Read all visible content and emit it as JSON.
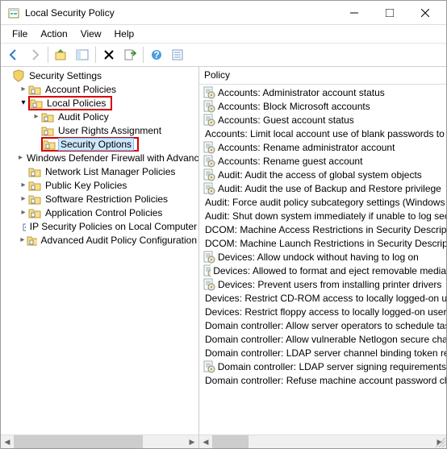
{
  "window": {
    "title": "Local Security Policy"
  },
  "menus": {
    "file": "File",
    "action": "Action",
    "view": "View",
    "help": "Help"
  },
  "tree": {
    "root": "Security Settings",
    "items": [
      {
        "label": "Account Policies",
        "indent": 1,
        "twisty": ">",
        "hl": false
      },
      {
        "label": "Local Policies",
        "indent": 1,
        "twisty": "v",
        "hl": true
      },
      {
        "label": "Audit Policy",
        "indent": 2,
        "twisty": ">",
        "hl": false
      },
      {
        "label": "User Rights Assignment",
        "indent": 2,
        "twisty": "",
        "hl": false
      },
      {
        "label": "Security Options",
        "indent": 2,
        "twisty": "",
        "hl": true,
        "sel": true
      },
      {
        "label": "Windows Defender Firewall with Advanced Security",
        "indent": 1,
        "twisty": ">",
        "hl": false
      },
      {
        "label": "Network List Manager Policies",
        "indent": 1,
        "twisty": "",
        "hl": false
      },
      {
        "label": "Public Key Policies",
        "indent": 1,
        "twisty": ">",
        "hl": false
      },
      {
        "label": "Software Restriction Policies",
        "indent": 1,
        "twisty": ">",
        "hl": false
      },
      {
        "label": "Application Control Policies",
        "indent": 1,
        "twisty": ">",
        "hl": false
      },
      {
        "label": "IP Security Policies on Local Computer",
        "indent": 1,
        "twisty": "",
        "hl": false,
        "icon": "ip"
      },
      {
        "label": "Advanced Audit Policy Configuration",
        "indent": 1,
        "twisty": ">",
        "hl": false
      }
    ]
  },
  "list": {
    "header": "Policy",
    "items": [
      "Accounts: Administrator account status",
      "Accounts: Block Microsoft accounts",
      "Accounts: Guest account status",
      "Accounts: Limit local account use of blank passwords to console logon only",
      "Accounts: Rename administrator account",
      "Accounts: Rename guest account",
      "Audit: Audit the access of global system objects",
      "Audit: Audit the use of Backup and Restore privilege",
      "Audit: Force audit policy subcategory settings (Windows Vista or later)",
      "Audit: Shut down system immediately if unable to log security audits",
      "DCOM: Machine Access Restrictions in Security Descriptor Definition Language",
      "DCOM: Machine Launch Restrictions in Security Descriptor Definition Language",
      "Devices: Allow undock without having to log on",
      "Devices: Allowed to format and eject removable media",
      "Devices: Prevent users from installing printer drivers",
      "Devices: Restrict CD-ROM access to locally logged-on user only",
      "Devices: Restrict floppy access to locally logged-on user only",
      "Domain controller: Allow server operators to schedule tasks",
      "Domain controller: Allow vulnerable Netlogon secure channel connections",
      "Domain controller: LDAP server channel binding token requirements",
      "Domain controller: LDAP server signing requirements",
      "Domain controller: Refuse machine account password changes"
    ]
  }
}
